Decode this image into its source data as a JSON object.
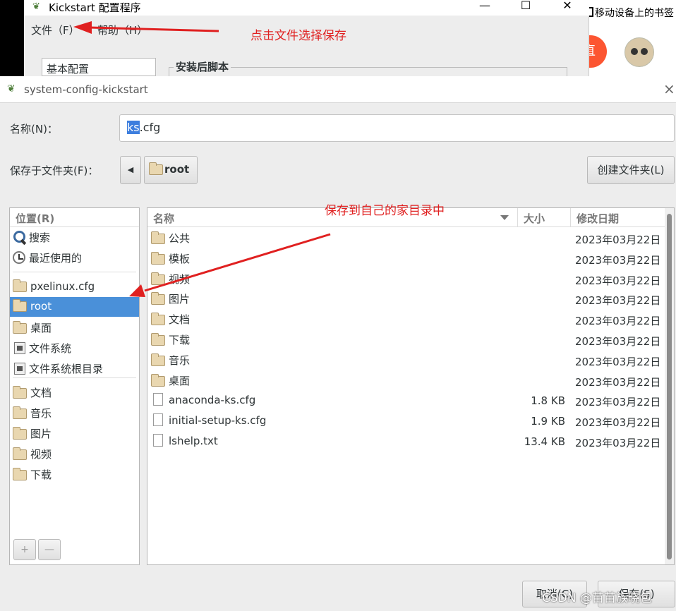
{
  "background": {
    "kickstart_title": "Kickstart 配置程序",
    "menu_file": "文件（F）",
    "menu_help": "帮助（H）",
    "sidebar_item": "基本配置",
    "section_title": "安装后脚本",
    "win_minimize": "—",
    "win_maximize": "☐",
    "win_close": "✕",
    "browser_bookmark_text": "移动设备上的书签",
    "browser_btn_text": "直"
  },
  "annotations": {
    "save_hint": "点击文件选择保存",
    "home_hint": "保存到自己的家目录中",
    "color": "#e02020"
  },
  "dialog": {
    "title": "system-config-kickstart",
    "close": "×",
    "name_label": "名称(N)：",
    "name_selected": "ks",
    "name_rest": ".cfg",
    "save_in_label": "保存于文件夹(F)：",
    "back": "◀",
    "path_current": "root",
    "create_folder": "创建文件夹(L)",
    "cancel": "取消(C)",
    "save": "保存(S)"
  },
  "places": {
    "header": "位置(R)",
    "items": [
      {
        "label": "搜索",
        "icon": "search-icon"
      },
      {
        "label": "最近使用的",
        "icon": "recent-icon"
      },
      {
        "label": "pxelinux.cfg",
        "icon": "folder-icon"
      },
      {
        "label": "root",
        "icon": "home-folder-icon",
        "selected": true
      },
      {
        "label": "桌面",
        "icon": "desktop-folder-icon"
      },
      {
        "label": "文件系统",
        "icon": "drive-icon"
      },
      {
        "label": "文件系统根目录",
        "icon": "drive-icon"
      },
      {
        "label": "文档",
        "icon": "documents-folder-icon"
      },
      {
        "label": "音乐",
        "icon": "music-folder-icon"
      },
      {
        "label": "图片",
        "icon": "pictures-folder-icon"
      },
      {
        "label": "视频",
        "icon": "videos-folder-icon"
      },
      {
        "label": "下载",
        "icon": "downloads-folder-icon"
      }
    ],
    "add": "+",
    "remove": "—"
  },
  "files": {
    "columns": [
      "名称",
      "大小",
      "修改日期"
    ],
    "rows": [
      {
        "name": "公共",
        "size": "",
        "date": "2023年03月22日",
        "type": "folder"
      },
      {
        "name": "模板",
        "size": "",
        "date": "2023年03月22日",
        "type": "folder"
      },
      {
        "name": "视频",
        "size": "",
        "date": "2023年03月22日",
        "type": "folder"
      },
      {
        "name": "图片",
        "size": "",
        "date": "2023年03月22日",
        "type": "folder"
      },
      {
        "name": "文档",
        "size": "",
        "date": "2023年03月22日",
        "type": "folder"
      },
      {
        "name": "下载",
        "size": "",
        "date": "2023年03月22日",
        "type": "folder"
      },
      {
        "name": "音乐",
        "size": "",
        "date": "2023年03月22日",
        "type": "folder"
      },
      {
        "name": "桌面",
        "size": "",
        "date": "2023年03月22日",
        "type": "folder"
      },
      {
        "name": "anaconda-ks.cfg",
        "size": "1.8 KB",
        "date": "2023年03月22日",
        "type": "file"
      },
      {
        "name": "initial-setup-ks.cfg",
        "size": "1.9 KB",
        "date": "2023年03月22日",
        "type": "file"
      },
      {
        "name": "lshelp.txt",
        "size": "13.4 KB",
        "date": "2023年03月22日",
        "type": "file"
      }
    ]
  },
  "watermark": "CSDN @苗苗族晓包"
}
